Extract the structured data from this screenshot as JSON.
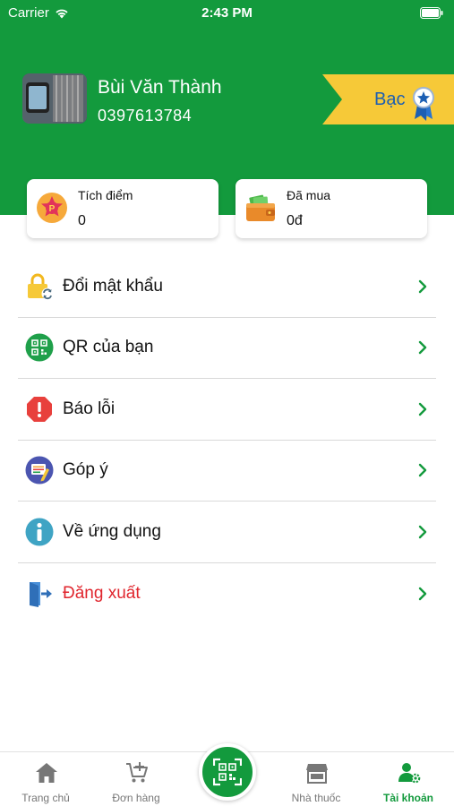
{
  "status_bar": {
    "carrier": "Carrier",
    "time": "2:43 PM"
  },
  "profile": {
    "name": "Bùi Văn Thành",
    "phone": "0397613784",
    "rank": "Bạc"
  },
  "cards": {
    "points": {
      "title": "Tích điểm",
      "value": "0",
      "icon": "points-coin-icon"
    },
    "bought": {
      "title": "Đã mua",
      "value": "0đ",
      "icon": "wallet-icon"
    }
  },
  "menu": [
    {
      "label": "Đổi mật khẩu",
      "icon": "lock-refresh-icon"
    },
    {
      "label": "QR của bạn",
      "icon": "qr-icon"
    },
    {
      "label": "Báo lỗi",
      "icon": "error-icon"
    },
    {
      "label": "Góp ý",
      "icon": "feedback-icon"
    },
    {
      "label": "Về ứng dụng",
      "icon": "info-icon"
    },
    {
      "label": "Đăng xuất",
      "icon": "logout-icon"
    }
  ],
  "tabs": [
    {
      "label": "Trang chủ",
      "icon": "home-icon"
    },
    {
      "label": "Đơn hàng",
      "icon": "cart-icon"
    },
    {
      "label": "Nhà thuốc",
      "icon": "store-icon"
    },
    {
      "label": "Tài khoản",
      "icon": "account-icon",
      "active": true
    }
  ],
  "colors": {
    "brand_green": "#139a3d",
    "rank_gold": "#f6c938",
    "rank_text": "#1c5fb3",
    "danger": "#e0262e",
    "chevron": "#139a3d"
  }
}
